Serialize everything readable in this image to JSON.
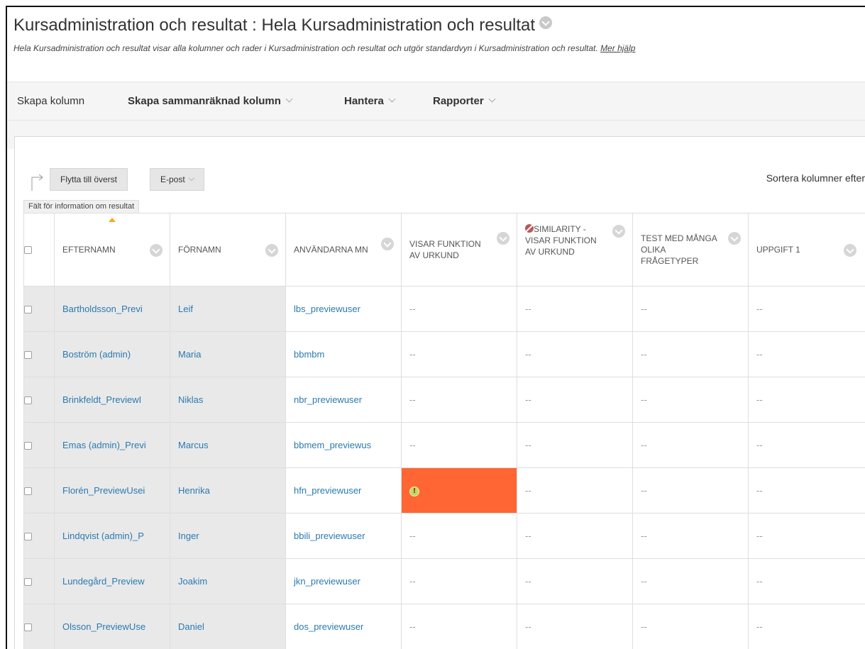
{
  "header": {
    "title": "Kursadministration och resultat : Hela Kursadministration och resultat",
    "description": "Hela Kursadministration och resultat visar alla kolumner och rader i Kursadministration och resultat och utgör standardvyn i Kursadministration och resultat.",
    "help_link": "Mer hjälp"
  },
  "action_bar": {
    "create_column": "Skapa kolumn",
    "create_calculated": "Skapa sammanräknad kolumn",
    "manage": "Hantera",
    "reports": "Rapporter"
  },
  "toolbar": {
    "move_to_top": "Flytta till överst",
    "email": "E-post",
    "sort_columns": "Sortera kolumner efter",
    "info_tab": "Fält för information om resultat"
  },
  "columns": {
    "lastname": "EFTERNAMN",
    "firstname": "FÖRNAMN",
    "username": "ANVÄNDARNA MN",
    "col1": "VISAR FUNKTION AV URKUND",
    "col2": "SIMILARITY - VISAR FUNKTION AV URKUND",
    "col3": "TEST MED MÅNGA OLIKA FRÅGETYPER",
    "col4": "UPPGIFT 1"
  },
  "empty_value": "--",
  "rows": [
    {
      "lastname": "Bartholdsson_Previ",
      "firstname": "Leif",
      "username": "lbs_previewuser"
    },
    {
      "lastname": "Boström (admin)",
      "firstname": "Maria",
      "username": "bbmbm"
    },
    {
      "lastname": "Brinkfeldt_PreviewІ",
      "firstname": "Niklas",
      "username": "nbr_previewuser"
    },
    {
      "lastname": "Emas (admin)_Previ",
      "firstname": "Marcus",
      "username": "bbmem_previewus"
    },
    {
      "lastname": "Florén_PreviewUsei",
      "firstname": "Henrika",
      "username": "hfn_previewuser"
    },
    {
      "lastname": "Lindqvist (admin)_P",
      "firstname": "Inger",
      "username": "bbili_previewuser"
    },
    {
      "lastname": "Lundegård_Preview",
      "firstname": "Joakim",
      "username": "jkn_previewuser"
    },
    {
      "lastname": "Olsson_PreviewUse",
      "firstname": "Daniel",
      "username": "dos_previewuser"
    }
  ],
  "colors": {
    "attention": "#ff6633",
    "link": "#2a7ab0",
    "sort_indicator": "#f5a623"
  }
}
